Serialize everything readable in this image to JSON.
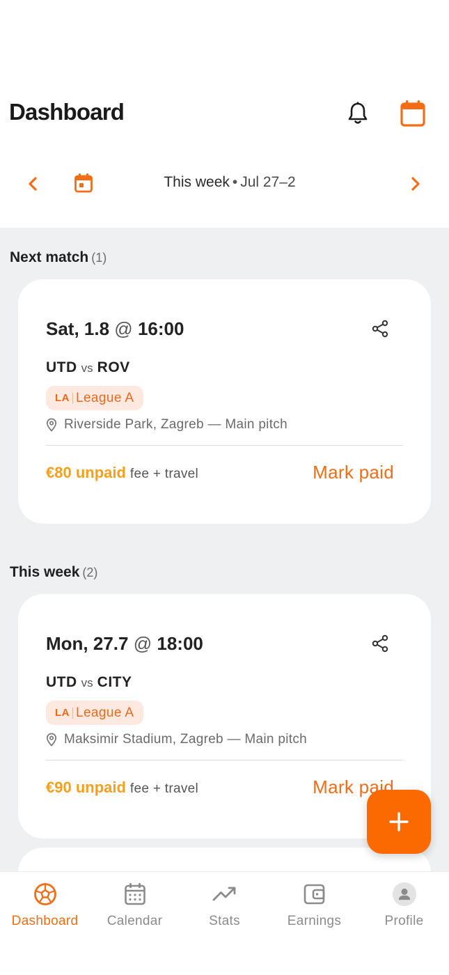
{
  "header": {
    "title": "Dashboard",
    "notifications_icon": "bell-icon",
    "calendar_icon": "calendar-icon"
  },
  "week_nav": {
    "label": "This week",
    "separator": "•",
    "range": "Jul 27–2",
    "prev_icon": "chevron-left-icon",
    "today_icon": "calendar-today-icon",
    "next_icon": "chevron-right-icon"
  },
  "sections": {
    "next_match": {
      "title": "Next match",
      "count": "(1)"
    },
    "this_week": {
      "title": "This week",
      "count": "(2)"
    }
  },
  "matches": [
    {
      "date": "Sat, 1.8",
      "at": "@",
      "time": "16:00",
      "home": "UTD",
      "vs": "vs",
      "away": "ROV",
      "league_abbr": "LA",
      "league_name": "League A",
      "venue": "Riverside Park, Zagreb — Main pitch",
      "amount": "€80 unpaid",
      "amount_note": "fee + travel",
      "action": "Mark paid"
    },
    {
      "date": "Mon, 27.7",
      "at": "@",
      "time": "18:00",
      "home": "UTD",
      "vs": "vs",
      "away": "CITY",
      "league_abbr": "LA",
      "league_name": "League A",
      "venue": "Maksimir Stadium, Zagreb — Main pitch",
      "amount": "€90 unpaid",
      "amount_note": "fee + travel",
      "action": "Mark paid"
    }
  ],
  "fab": {
    "icon": "plus-icon"
  },
  "bottom_nav": [
    {
      "label": "Dashboard",
      "icon": "soccer-ball-icon",
      "active": true
    },
    {
      "label": "Calendar",
      "icon": "calendar-icon",
      "active": false
    },
    {
      "label": "Stats",
      "icon": "trending-up-icon",
      "active": false
    },
    {
      "label": "Earnings",
      "icon": "wallet-icon",
      "active": false
    },
    {
      "label": "Profile",
      "icon": "profile-icon",
      "active": false
    }
  ],
  "colors": {
    "accent": "#f26d15",
    "fab": "#fb6a00",
    "unpaid": "#f5a01d",
    "chip_bg": "#fde9df",
    "background": "#eef0f2"
  }
}
